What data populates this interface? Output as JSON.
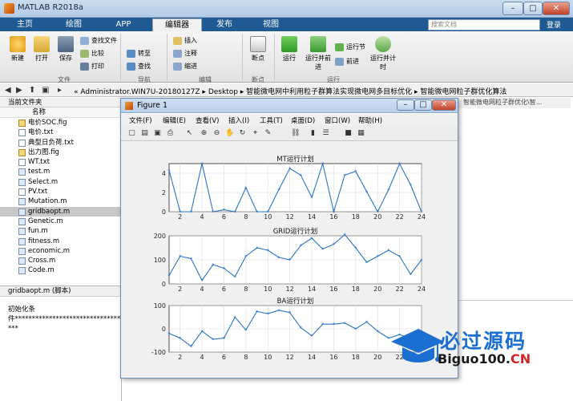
{
  "window": {
    "title": "MATLAB R2018a",
    "min": "–",
    "max": "□",
    "close": "✕"
  },
  "tabs": [
    "主页",
    "绘图",
    "APP",
    "编辑器",
    "发布",
    "视图"
  ],
  "search": {
    "placeholder": "搜索文档"
  },
  "login_label": "登录",
  "ribbon": {
    "file_group": {
      "new": "新建",
      "open": "打开",
      "save": "保存",
      "find_files": "查找文件",
      "compare": "比较",
      "print": "打印",
      "label": "文件"
    },
    "nav_group": {
      "goto": "转至",
      "find": "查找",
      "label": "导航"
    },
    "edit_group": {
      "insert": "插入",
      "comment": "注释",
      "indent": "缩进",
      "label": "编辑"
    },
    "breakpoint_group": {
      "breakpoint": "断点",
      "label": "断点"
    },
    "run_group": {
      "run": "运行",
      "run_advance": "运行并前进",
      "run_section": "运行节",
      "advance": "前进",
      "run_time": "运行并计时",
      "label": "运行"
    }
  },
  "address": {
    "path": "« Administrator.WIN7U-20180127Z ▸ Desktop ▸ 智能微电网中利用粒子群算法实现微电网多目标优化 ▸ 智能微电网粒子群优化算法"
  },
  "current_folder": {
    "title": "当前文件夹",
    "column": "名称",
    "files": [
      {
        "name": "电价SOC.fig",
        "type": "fig"
      },
      {
        "name": "电价.txt",
        "type": "txt"
      },
      {
        "name": "典型日负荷.txt",
        "type": "txt"
      },
      {
        "name": "出力图.fig",
        "type": "fig"
      },
      {
        "name": "WT.txt",
        "type": "txt"
      },
      {
        "name": "test.m",
        "type": "m"
      },
      {
        "name": "Select.m",
        "type": "m"
      },
      {
        "name": "PV.txt",
        "type": "txt"
      },
      {
        "name": "Mutation.m",
        "type": "m"
      },
      {
        "name": "gridbaopt.m",
        "type": "m",
        "selected": true
      },
      {
        "name": "Genetic.m",
        "type": "m"
      },
      {
        "name": "fun.m",
        "type": "m"
      },
      {
        "name": "fitness.m",
        "type": "m"
      },
      {
        "name": "economic.m",
        "type": "m"
      },
      {
        "name": "Cross.m",
        "type": "m"
      },
      {
        "name": "Code.m",
        "type": "m"
      }
    ]
  },
  "details": {
    "title": "gridbaopt.m  (脚本)",
    "line1": "初始化条",
    "line2": "件******************************************",
    "line3": "***"
  },
  "editor_tab": "智能微电网粒子群优化\\智...",
  "figure": {
    "title": "Figure 1",
    "menus": [
      "文件(F)",
      "编辑(E)",
      "查看(V)",
      "插入(I)",
      "工具(T)",
      "桌面(D)",
      "窗口(W)",
      "帮助(H)"
    ]
  },
  "chart_data": [
    {
      "type": "line",
      "title": "MT运行计划",
      "x": [
        1,
        2,
        3,
        4,
        5,
        6,
        7,
        8,
        9,
        10,
        11,
        12,
        13,
        14,
        15,
        16,
        17,
        18,
        19,
        20,
        21,
        22,
        23,
        24
      ],
      "y": [
        4.3,
        0,
        0,
        5,
        0,
        0.2,
        0,
        2.5,
        0,
        0,
        2.3,
        4.5,
        3.8,
        1.5,
        5,
        0,
        3.8,
        4.2,
        2.1,
        0,
        2.3,
        5,
        2.8,
        0
      ],
      "ylim": [
        0,
        5
      ],
      "yticks": [
        0,
        2,
        4
      ],
      "xticks": [
        2,
        4,
        6,
        8,
        10,
        12,
        14,
        16,
        18,
        20,
        22,
        24
      ],
      "color": "#2a74c6",
      "grid": true
    },
    {
      "type": "line",
      "title": "GRID运行计划",
      "x": [
        1,
        2,
        3,
        4,
        5,
        6,
        7,
        8,
        9,
        10,
        11,
        12,
        13,
        14,
        15,
        16,
        17,
        18,
        19,
        20,
        21,
        22,
        23,
        24
      ],
      "y": [
        35,
        115,
        105,
        15,
        80,
        65,
        30,
        115,
        150,
        140,
        110,
        100,
        160,
        190,
        145,
        165,
        205,
        150,
        90,
        115,
        140,
        115,
        40,
        100
      ],
      "ylim": [
        0,
        200
      ],
      "yticks": [
        0,
        100,
        200
      ],
      "xticks": [
        2,
        4,
        6,
        8,
        10,
        12,
        14,
        16,
        18,
        20,
        22,
        24
      ],
      "color": "#2a74c6",
      "grid": true
    },
    {
      "type": "line",
      "title": "BA运行计划",
      "x": [
        1,
        2,
        3,
        4,
        5,
        6,
        7,
        8,
        9,
        10,
        11,
        12,
        13,
        14,
        15,
        16,
        17,
        18,
        19,
        20,
        21,
        22,
        23,
        24
      ],
      "y": [
        -20,
        -40,
        -75,
        -10,
        -45,
        -40,
        50,
        -5,
        75,
        65,
        80,
        70,
        5,
        -30,
        20,
        20,
        25,
        0,
        30,
        -10,
        -40,
        -25,
        -40,
        -50
      ],
      "ylim": [
        -100,
        100
      ],
      "yticks": [
        -100,
        0,
        100
      ],
      "xticks": [
        2,
        4,
        6,
        8,
        10,
        12,
        14,
        16,
        18,
        20,
        22,
        24
      ],
      "color": "#2a74c6",
      "grid": true
    }
  ],
  "watermark": {
    "main": "必过源码",
    "url_main": "Biguo100.",
    "url_suffix": "CN"
  }
}
